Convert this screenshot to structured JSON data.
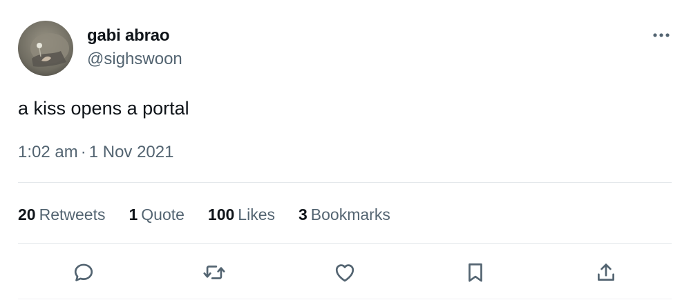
{
  "tweet": {
    "author": {
      "display_name": "gabi abrao",
      "handle": "@sighswoon"
    },
    "text": "a kiss opens a portal",
    "time": "1:02 am",
    "separator": "·",
    "date": "1 Nov 2021"
  },
  "stats": [
    {
      "value": "20",
      "label": "Retweets"
    },
    {
      "value": "1",
      "label": "Quote"
    },
    {
      "value": "100",
      "label": "Likes"
    },
    {
      "value": "3",
      "label": "Bookmarks"
    }
  ],
  "icons": {
    "more": "more-horizontal-icon",
    "reply": "reply-bubble-icon",
    "retweet": "retweet-arrows-icon",
    "like": "heart-icon",
    "bookmark": "bookmark-icon",
    "share": "share-upload-icon"
  },
  "colors": {
    "text_primary": "#0f1419",
    "text_secondary": "#536471",
    "divider": "#e3e7ea",
    "icon": "#536471"
  }
}
